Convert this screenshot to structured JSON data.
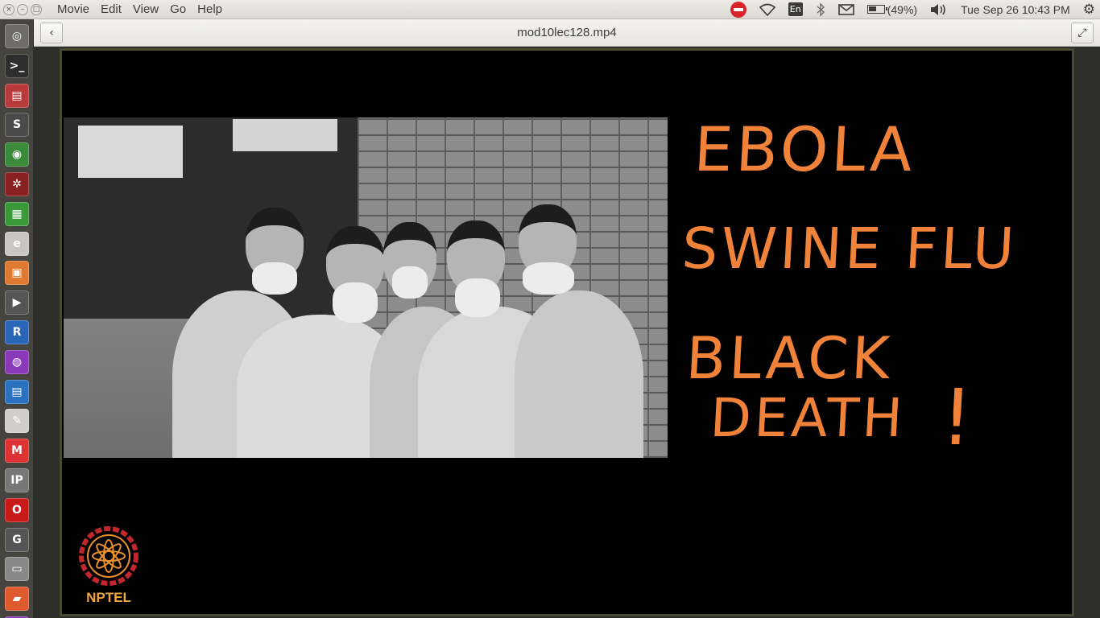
{
  "window_buttons": {
    "close": "×",
    "minimize": "–",
    "maximize": "□"
  },
  "menubar": [
    "Movie",
    "Edit",
    "View",
    "Go",
    "Help"
  ],
  "indicators": {
    "keyboard": "En",
    "battery": "(49%)",
    "clock": "Tue Sep 26 10:43 PM"
  },
  "titlebar": {
    "title": "mod10lec128.mp4",
    "back_glyph": "‹",
    "fullscreen_glyph": "⤢"
  },
  "launcher_icons": [
    {
      "name": "dash-icon",
      "glyph": "◎",
      "color": "#6d6c66"
    },
    {
      "name": "terminal-icon",
      "glyph": ">_",
      "color": "#2e2e2e"
    },
    {
      "name": "files-icon",
      "glyph": "▤",
      "color": "#b83a3a"
    },
    {
      "name": "sublime-icon",
      "glyph": "S",
      "color": "#4a4a4a"
    },
    {
      "name": "chrome-icon",
      "glyph": "◉",
      "color": "#3b8a3b"
    },
    {
      "name": "network-icon",
      "glyph": "✲",
      "color": "#8a2020"
    },
    {
      "name": "spreadsheet-icon",
      "glyph": "▦",
      "color": "#3a9a3a"
    },
    {
      "name": "document-viewer-icon",
      "glyph": "e",
      "color": "#c9c6c0"
    },
    {
      "name": "impress-icon",
      "glyph": "▣",
      "color": "#e07a30"
    },
    {
      "name": "video-editor-icon",
      "glyph": "▶",
      "color": "#555"
    },
    {
      "name": "r-icon",
      "glyph": "R",
      "color": "#2a66b8"
    },
    {
      "name": "media-player-icon",
      "glyph": "◍",
      "color": "#8a3ab8"
    },
    {
      "name": "writer-icon",
      "glyph": "▤",
      "color": "#2a72c0"
    },
    {
      "name": "text-editor-icon",
      "glyph": "✎",
      "color": "#d0cec8"
    },
    {
      "name": "gmail-icon",
      "glyph": "M",
      "color": "#d33"
    },
    {
      "name": "ipython-icon",
      "glyph": "IP",
      "color": "#777"
    },
    {
      "name": "opera-icon",
      "glyph": "O",
      "color": "#c91a1a"
    },
    {
      "name": "gp-icon",
      "glyph": "G",
      "color": "#555"
    },
    {
      "name": "drive-icon",
      "glyph": "▭",
      "color": "#888"
    },
    {
      "name": "presentation-icon",
      "glyph": "▰",
      "color": "#e05a30"
    },
    {
      "name": "trash-icon",
      "glyph": "▥",
      "color": "#8a3ab8"
    }
  ],
  "video": {
    "line1": "EBOLA",
    "line2": "SWINE FLU",
    "line3": "BLACK",
    "line4": "DEATH",
    "mark": "!",
    "logo_text": "NPTEL"
  },
  "colors": {
    "accent_text": "#f0823a",
    "logo": "#f0a640"
  }
}
